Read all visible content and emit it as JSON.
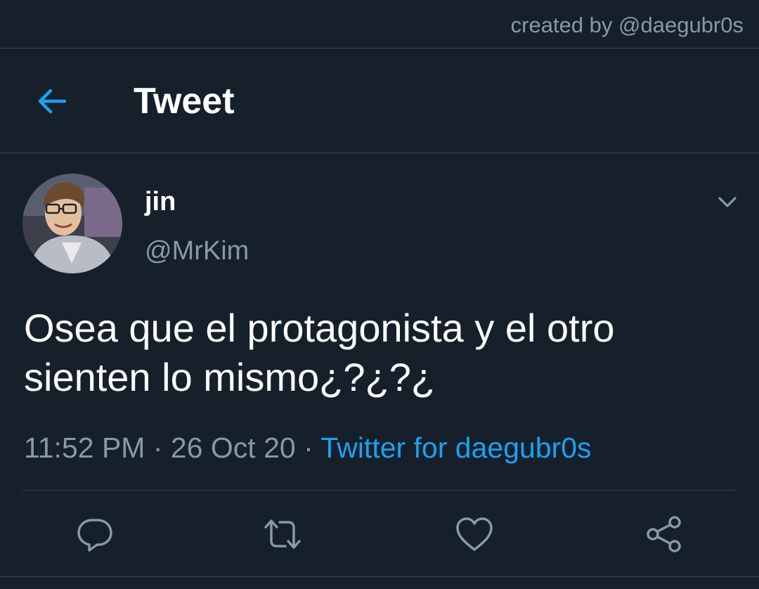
{
  "watermark": {
    "text": "created by @daegubr0s"
  },
  "header": {
    "title": "Tweet",
    "back_icon": "arrow-left-icon"
  },
  "author": {
    "name": "jin",
    "handle": "@MrKim"
  },
  "tweet": {
    "text": "Osea que el protagonista y el otro sienten lo mismo¿?¿?¿",
    "time": "11:52 PM",
    "date": "26 Oct 20",
    "separator": "·",
    "source": "Twitter for daegubr0s"
  },
  "actions": [
    {
      "icon": "reply-icon"
    },
    {
      "icon": "retweet-icon"
    },
    {
      "icon": "like-icon"
    },
    {
      "icon": "share-icon"
    }
  ],
  "colors": {
    "background": "#15202b",
    "accent": "#1da1f2",
    "muted": "#8899a6",
    "border": "#38444d"
  }
}
